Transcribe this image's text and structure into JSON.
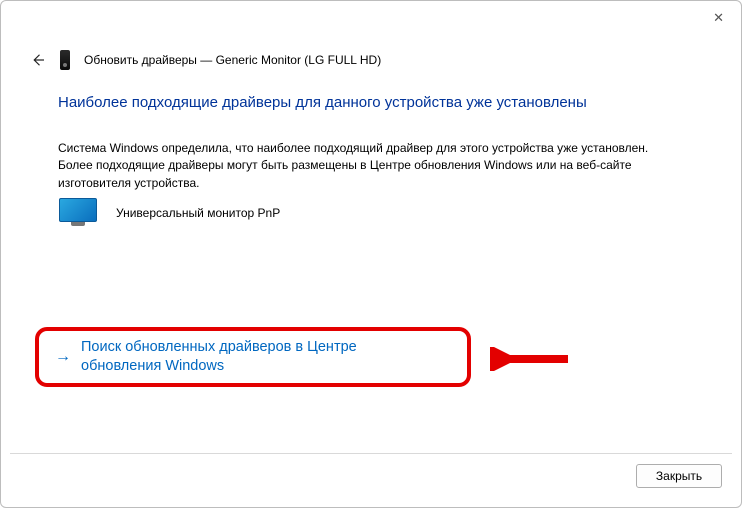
{
  "header": {
    "title": "Обновить драйверы — Generic Monitor (LG FULL HD)"
  },
  "main": {
    "heading": "Наиболее подходящие драйверы для данного устройства уже установлены",
    "description": "Система Windows определила, что наиболее подходящий драйвер для этого устройства уже установлен. Более подходящие драйверы могут быть размещены в Центре обновления Windows или на веб-сайте изготовителя устройства.",
    "device_name": "Универсальный монитор PnP",
    "search_link": "Поиск обновленных драйверов в Центре обновления Windows"
  },
  "footer": {
    "close_label": "Закрыть"
  }
}
